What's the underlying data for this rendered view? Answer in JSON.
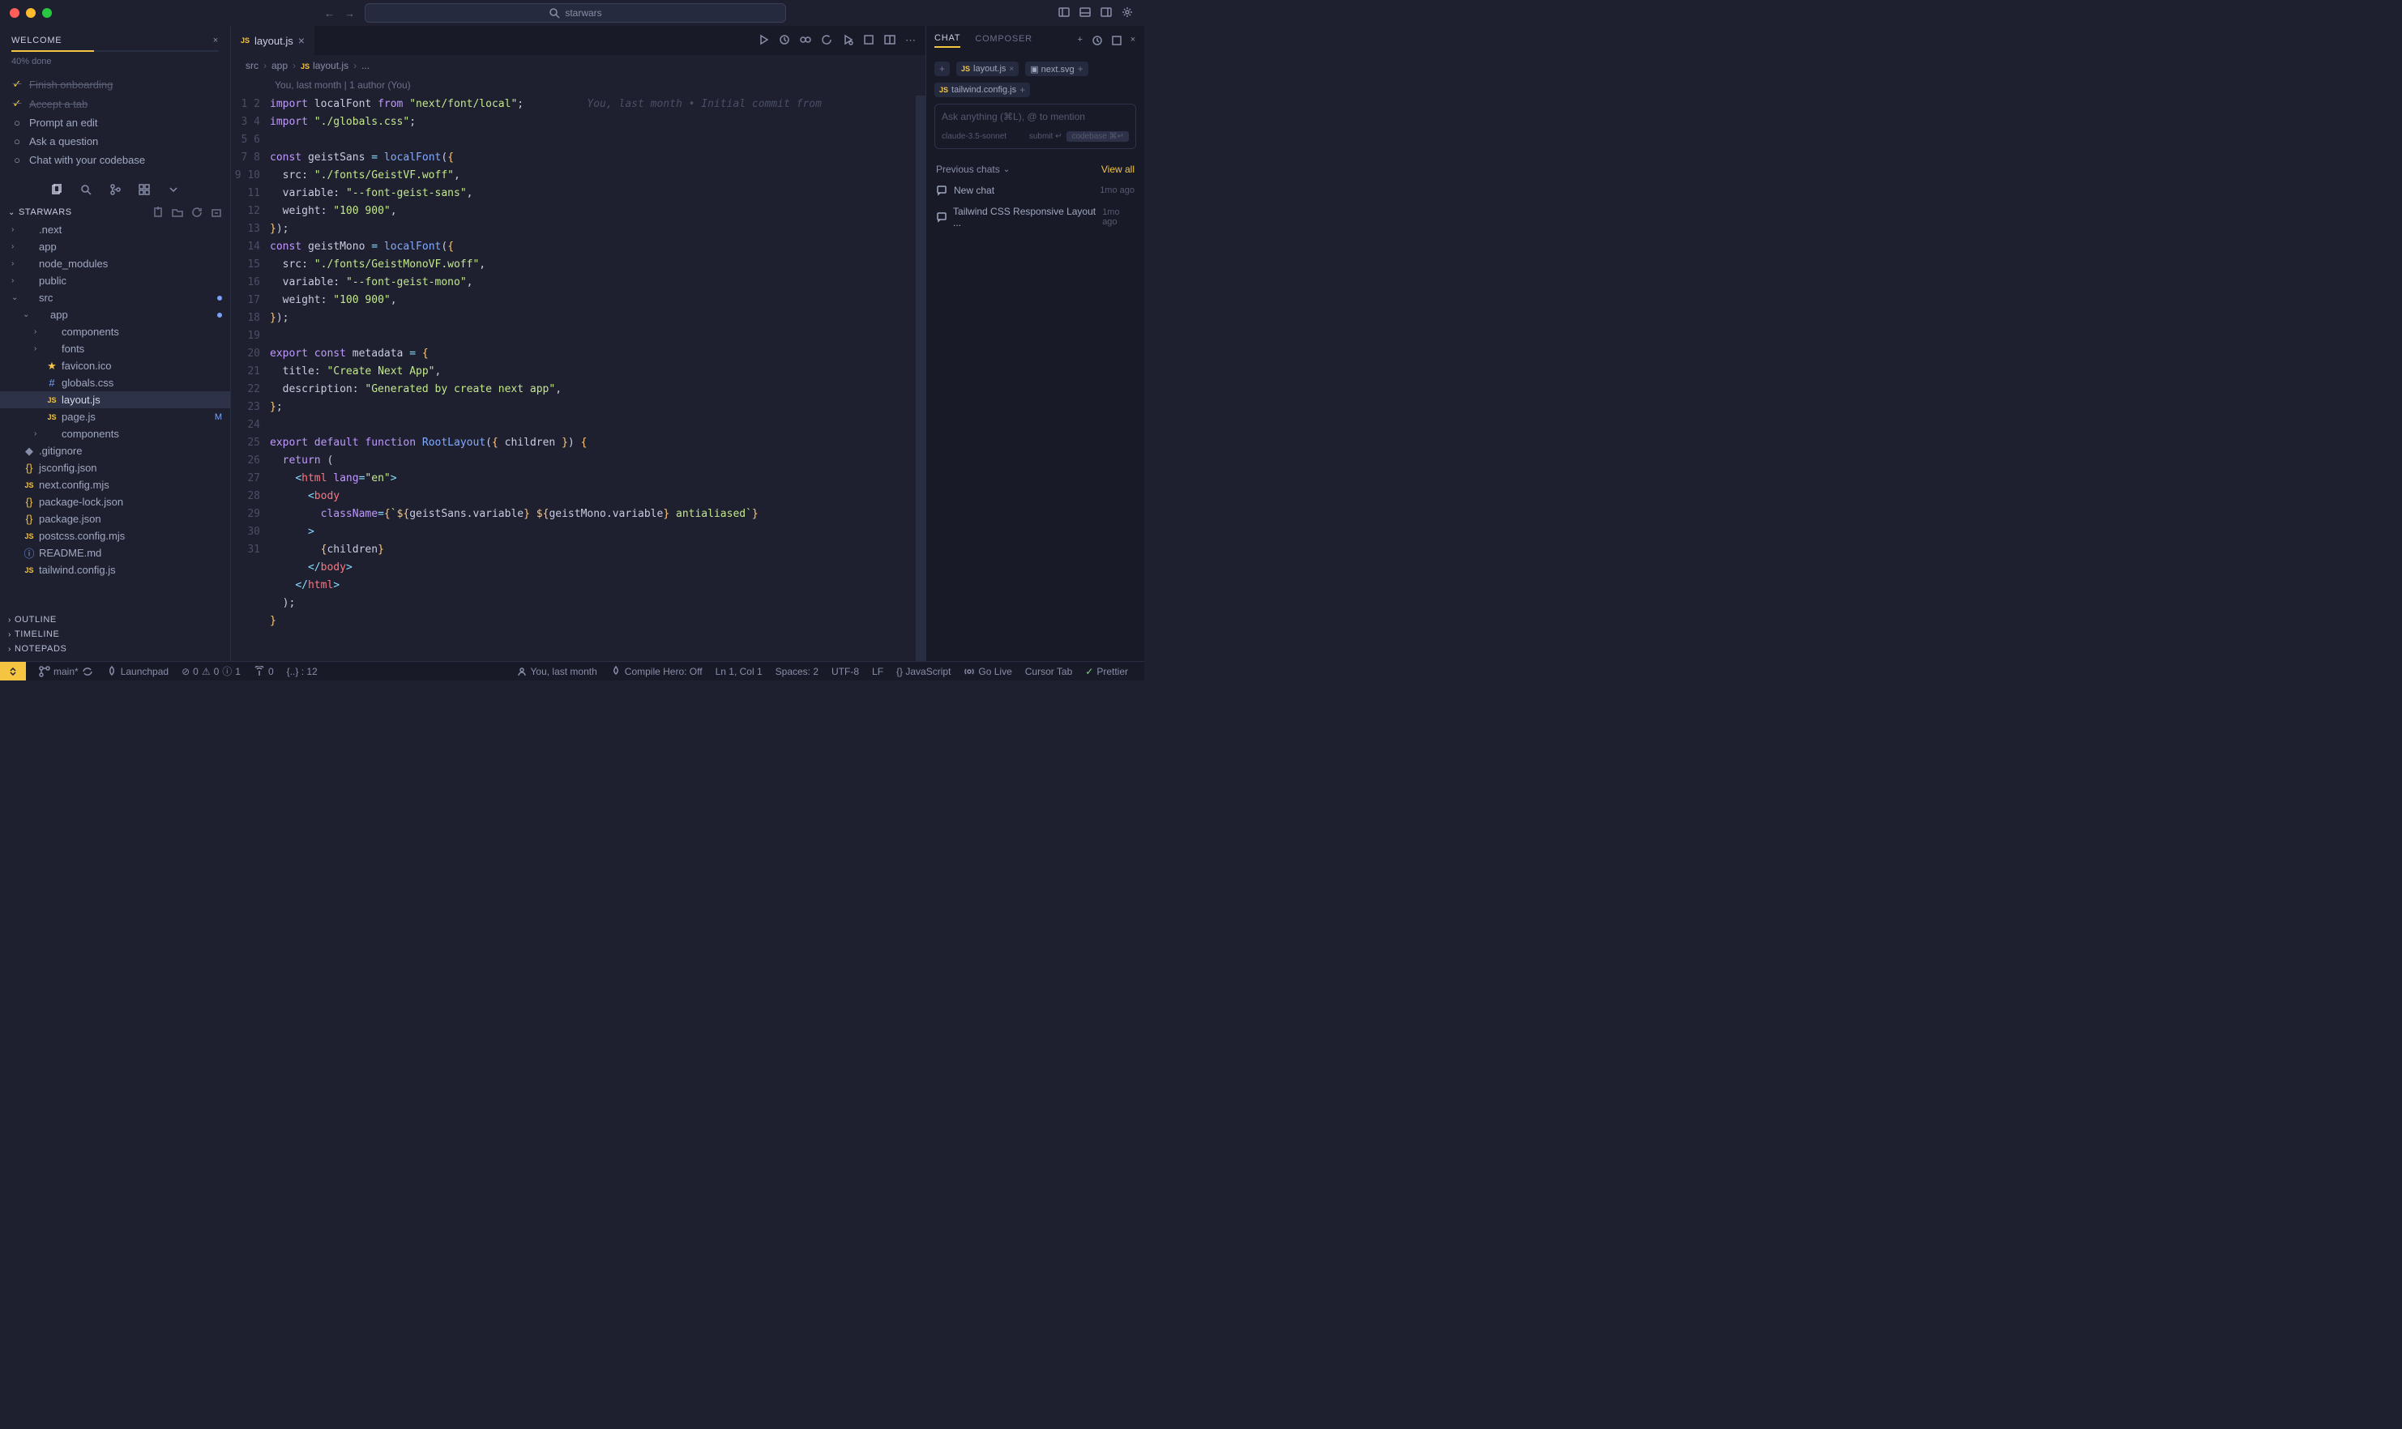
{
  "titlebar": {
    "search_text": "starwars"
  },
  "welcome": {
    "title": "WELCOME",
    "progress_percent": 40,
    "progress_text": "40% done",
    "items": [
      {
        "label": "Finish onboarding",
        "done": true,
        "icon": "check"
      },
      {
        "label": "Accept a tab",
        "done": true,
        "icon": "check"
      },
      {
        "label": "Prompt an edit",
        "done": false,
        "icon": "circle"
      },
      {
        "label": "Ask a question",
        "done": false,
        "icon": "circle"
      },
      {
        "label": "Chat with your codebase",
        "done": false,
        "icon": "circle"
      }
    ]
  },
  "explorer": {
    "title": "STARWARS",
    "tree": [
      {
        "depth": 0,
        "chev": "›",
        "icon": "",
        "label": ".next"
      },
      {
        "depth": 0,
        "chev": "›",
        "icon": "",
        "label": "app"
      },
      {
        "depth": 0,
        "chev": "›",
        "icon": "",
        "label": "node_modules"
      },
      {
        "depth": 0,
        "chev": "›",
        "icon": "",
        "label": "public"
      },
      {
        "depth": 0,
        "chev": "⌄",
        "icon": "",
        "label": "src",
        "mod": "dot"
      },
      {
        "depth": 1,
        "chev": "⌄",
        "icon": "",
        "label": "app",
        "mod": "dot"
      },
      {
        "depth": 2,
        "chev": "›",
        "icon": "",
        "label": "components"
      },
      {
        "depth": 2,
        "chev": "›",
        "icon": "",
        "label": "fonts"
      },
      {
        "depth": 2,
        "chev": "",
        "icon": "star",
        "label": "favicon.ico"
      },
      {
        "depth": 2,
        "chev": "",
        "icon": "hash",
        "label": "globals.css"
      },
      {
        "depth": 2,
        "chev": "",
        "icon": "js",
        "label": "layout.js",
        "selected": true
      },
      {
        "depth": 2,
        "chev": "",
        "icon": "js",
        "label": "page.js",
        "mod": "M"
      },
      {
        "depth": 2,
        "chev": "›",
        "icon": "",
        "label": "components"
      },
      {
        "depth": 0,
        "chev": "",
        "icon": "git",
        "label": ".gitignore"
      },
      {
        "depth": 0,
        "chev": "",
        "icon": "brace",
        "label": "jsconfig.json"
      },
      {
        "depth": 0,
        "chev": "",
        "icon": "js",
        "label": "next.config.mjs"
      },
      {
        "depth": 0,
        "chev": "",
        "icon": "brace",
        "label": "package-lock.json"
      },
      {
        "depth": 0,
        "chev": "",
        "icon": "brace",
        "label": "package.json"
      },
      {
        "depth": 0,
        "chev": "",
        "icon": "js",
        "label": "postcss.config.mjs"
      },
      {
        "depth": 0,
        "chev": "",
        "icon": "info",
        "label": "README.md"
      },
      {
        "depth": 0,
        "chev": "",
        "icon": "js",
        "label": "tailwind.config.js"
      }
    ],
    "footer_sections": [
      "OUTLINE",
      "TIMELINE",
      "NOTEPADS"
    ]
  },
  "editor": {
    "tab_icon": "JS",
    "tab_label": "layout.js",
    "breadcrumb": [
      "src",
      "app",
      "layout.js",
      "..."
    ],
    "blame_header": "You, last month | 1 author (You)",
    "blame_inline": "You, last month • Initial commit from",
    "lines": 31
  },
  "chat": {
    "tabs": [
      "CHAT",
      "COMPOSER"
    ],
    "active_tab": 0,
    "chips": [
      {
        "icon": "plus",
        "label": ""
      },
      {
        "icon": "js",
        "label": "layout.js",
        "closable": true
      },
      {
        "icon": "svg",
        "label": "next.svg",
        "plus": true
      },
      {
        "icon": "js",
        "label": "tailwind.config.js",
        "plus": true
      }
    ],
    "prompt_placeholder": "Ask anything (⌘L), @ to mention",
    "model": "claude-3.5-sonnet",
    "submit_label": "submit ↵",
    "codebase_label": "codebase ⌘↵",
    "prev_chats_label": "Previous chats",
    "view_all_label": "View all",
    "history": [
      {
        "label": "New chat",
        "ts": "1mo ago"
      },
      {
        "label": "Tailwind CSS Responsive Layout ...",
        "ts": "1mo ago"
      }
    ]
  },
  "statusbar": {
    "branch": "main*",
    "launchpad": "Launchpad",
    "errors": "0",
    "warnings": "0",
    "infos": "1",
    "ports": "0",
    "json": "{..} : 12",
    "blame": "You, last month",
    "compile": "Compile Hero: Off",
    "cursor": "Ln 1, Col 1",
    "spaces": "Spaces: 2",
    "encoding": "UTF-8",
    "eol": "LF",
    "lang": "{} JavaScript",
    "golive": "Go Live",
    "cursortab": "Cursor Tab",
    "prettier": "Prettier"
  }
}
